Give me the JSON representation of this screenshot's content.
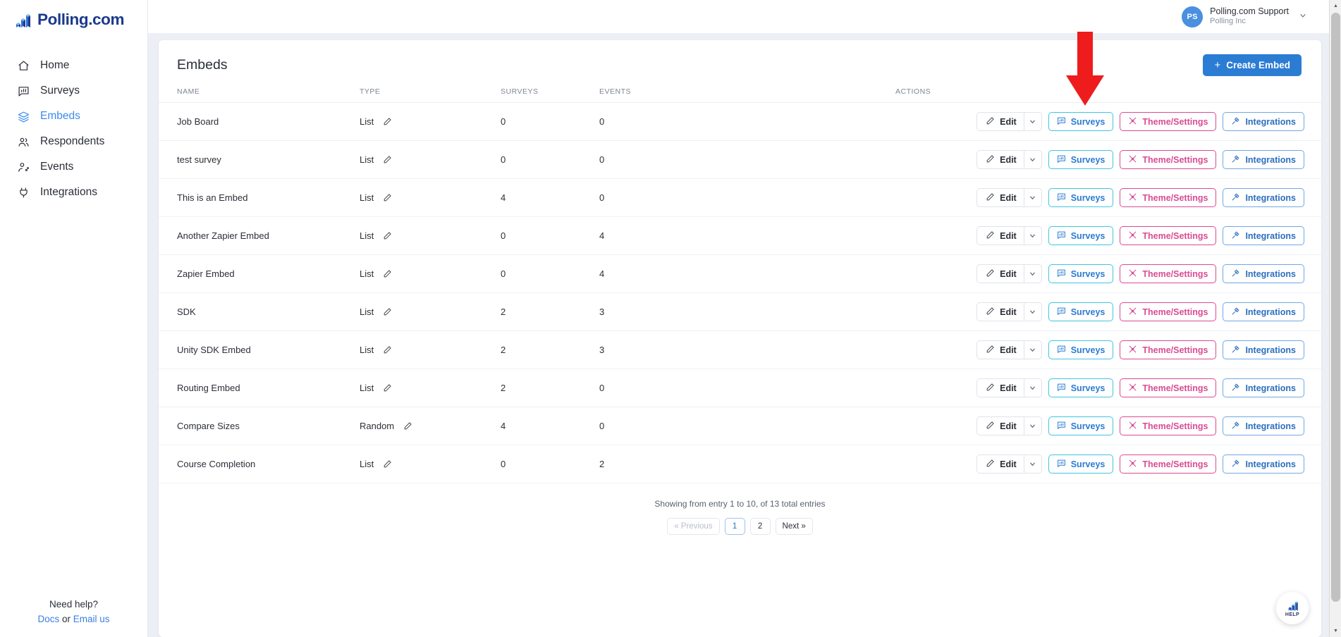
{
  "brand": {
    "name": "Polling.com",
    "logo_icon": "bar-chart-logo-icon",
    "primary_color": "#1b3a8c",
    "accent_color": "#2b7cd3"
  },
  "sidebar": {
    "items": [
      {
        "label": "Home",
        "icon": "home-icon",
        "active": false
      },
      {
        "label": "Surveys",
        "icon": "survey-icon",
        "active": false
      },
      {
        "label": "Embeds",
        "icon": "layers-icon",
        "active": true
      },
      {
        "label": "Respondents",
        "icon": "users-icon",
        "active": false
      },
      {
        "label": "Events",
        "icon": "user-activity-icon",
        "active": false
      },
      {
        "label": "Integrations",
        "icon": "plug-icon",
        "active": false
      }
    ],
    "help": {
      "title": "Need help?",
      "docs_label": "Docs",
      "separator": " or ",
      "email_label": "Email us"
    }
  },
  "topbar": {
    "user": {
      "initials": "PS",
      "name": "Polling.com Support",
      "org": "Polling Inc",
      "caret_icon": "chevron-down-icon"
    }
  },
  "page": {
    "title": "Embeds",
    "create_button": {
      "label": "Create Embed",
      "icon": "plus-icon"
    }
  },
  "table": {
    "columns": [
      "NAME",
      "TYPE",
      "SURVEYS",
      "EVENTS",
      "ACTIONS"
    ],
    "row_actions": {
      "edit": {
        "label": "Edit",
        "icon": "pencil-icon",
        "caret_icon": "chevron-down-icon"
      },
      "surveys": {
        "label": "Surveys",
        "icon": "survey-icon",
        "color": "#3ec6e0"
      },
      "theme": {
        "label": "Theme/Settings",
        "icon": "palette-icon",
        "color": "#d94b93"
      },
      "integrations": {
        "label": "Integrations",
        "icon": "plug-icon",
        "color": "#6fa8e8"
      }
    },
    "type_edit_icon": "pencil-icon",
    "rows": [
      {
        "name": "Job Board",
        "type": "List",
        "surveys": "0",
        "events": "0"
      },
      {
        "name": "test survey",
        "type": "List",
        "surveys": "0",
        "events": "0"
      },
      {
        "name": "This is an Embed",
        "type": "List",
        "surveys": "4",
        "events": "0"
      },
      {
        "name": "Another Zapier Embed",
        "type": "List",
        "surveys": "0",
        "events": "4"
      },
      {
        "name": "Zapier Embed",
        "type": "List",
        "surveys": "0",
        "events": "4"
      },
      {
        "name": "SDK",
        "type": "List",
        "surveys": "2",
        "events": "3"
      },
      {
        "name": "Unity SDK Embed",
        "type": "List",
        "surveys": "2",
        "events": "3"
      },
      {
        "name": "Routing Embed",
        "type": "List",
        "surveys": "2",
        "events": "0"
      },
      {
        "name": "Compare Sizes",
        "type": "Random",
        "surveys": "4",
        "events": "0"
      },
      {
        "name": "Course Completion",
        "type": "List",
        "surveys": "0",
        "events": "2"
      }
    ]
  },
  "pagination": {
    "info": "Showing from entry 1 to 10, of 13 total entries",
    "previous_label": "« Previous",
    "pages": [
      "1",
      "2"
    ],
    "current_page": "1",
    "next_label": "Next »"
  },
  "help_widget": {
    "label": "HELP",
    "icon": "bar-chart-logo-icon"
  },
  "annotation": {
    "type": "red-down-arrow",
    "color": "#ee1c1c",
    "points_at": "surveys-button-row-1"
  }
}
